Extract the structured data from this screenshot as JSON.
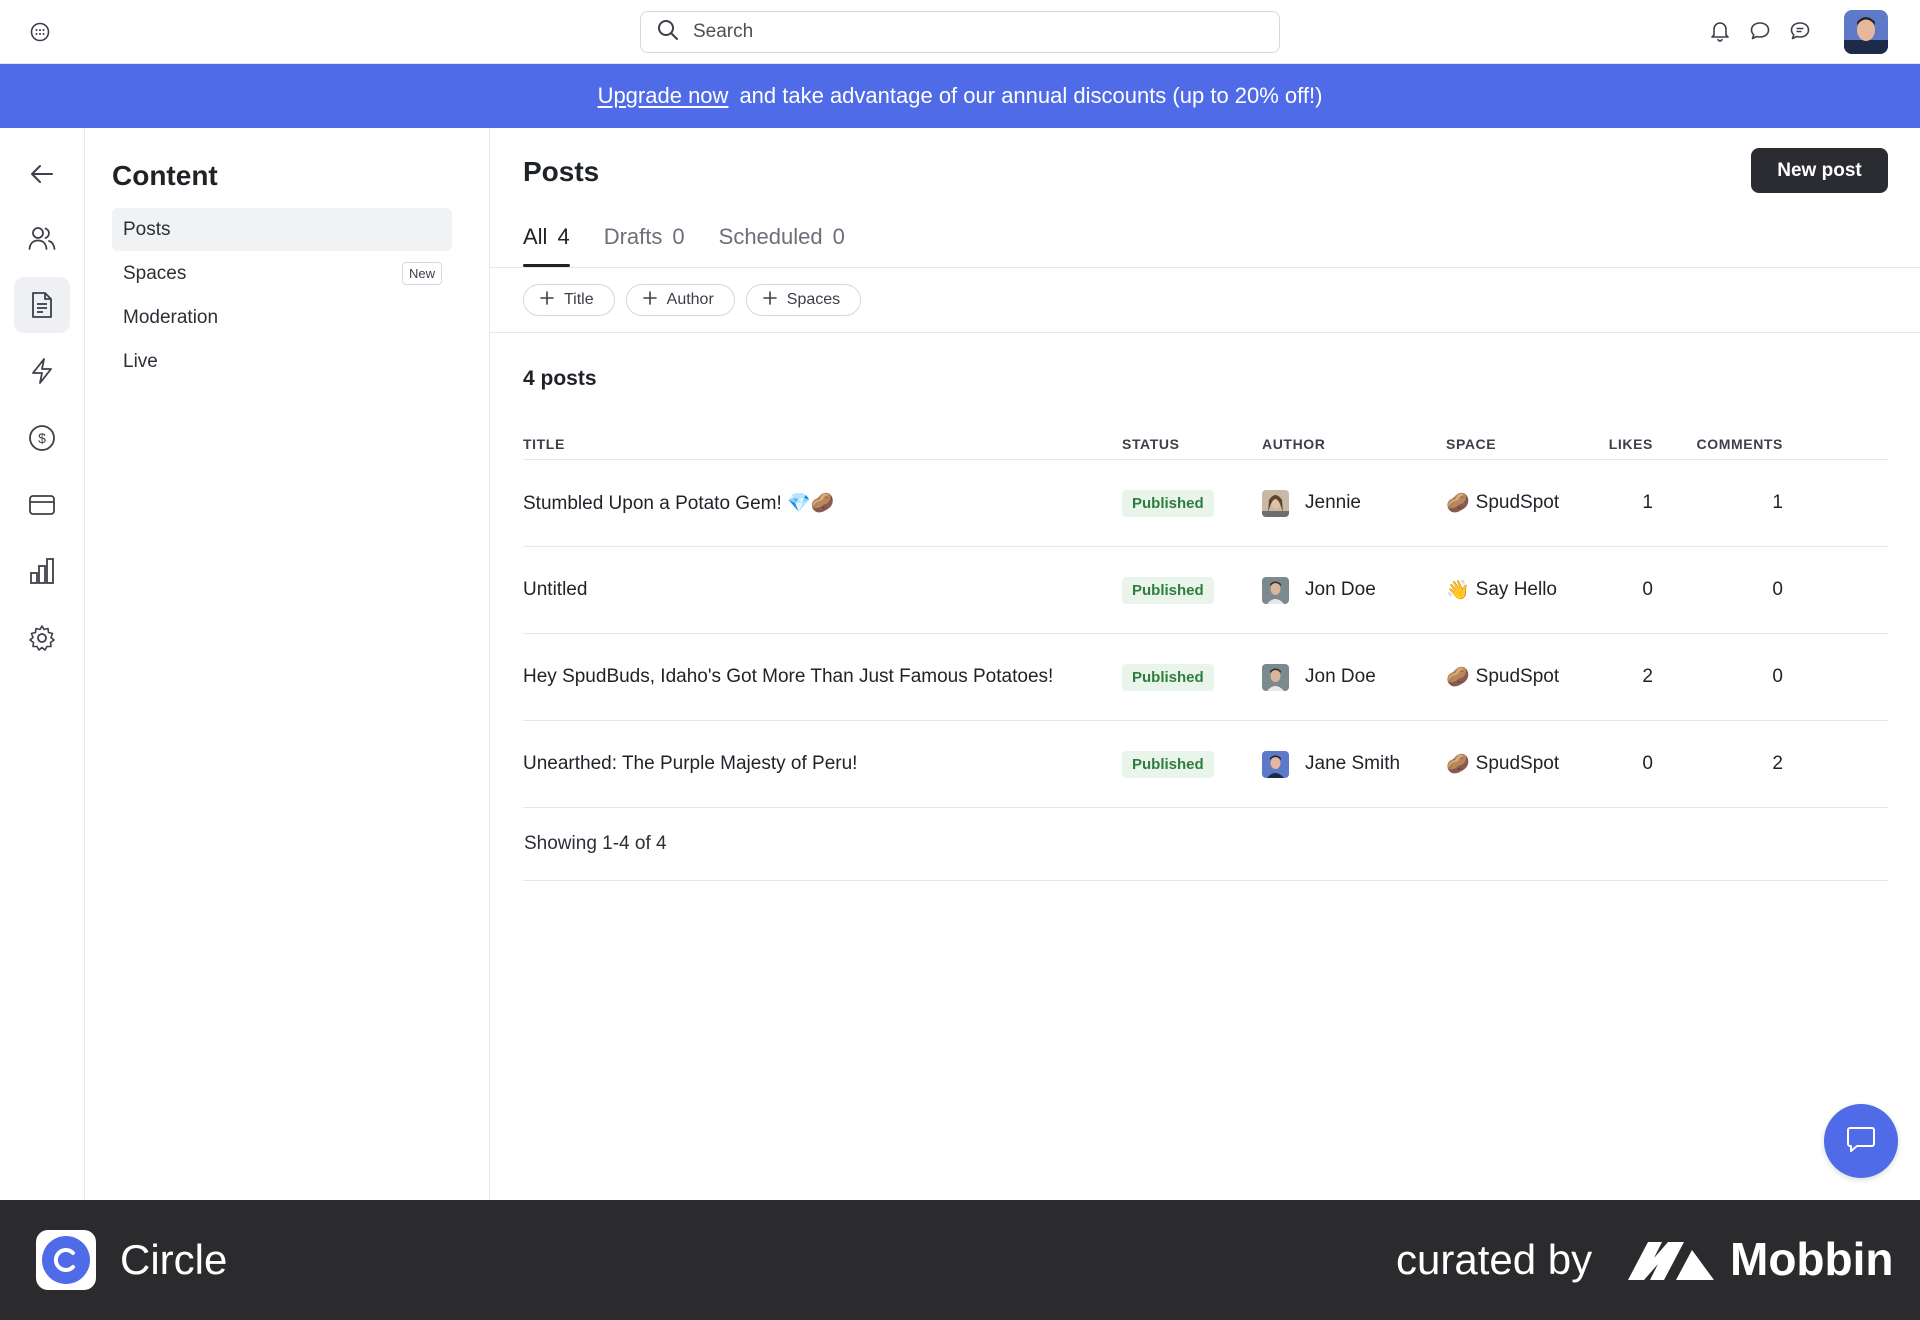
{
  "topbar": {
    "search_placeholder": "Search"
  },
  "banner": {
    "link_text": "Upgrade now",
    "text": "and take advantage of our annual discounts (up to 20% off!)"
  },
  "rail": {
    "items": [
      "back-arrow-icon",
      "members-icon",
      "content-icon",
      "workflows-icon",
      "paywalls-icon",
      "billing-icon",
      "analytics-icon",
      "settings-icon"
    ],
    "active": "content-icon"
  },
  "sidebar": {
    "title": "Content",
    "items": [
      {
        "label": "Posts",
        "active": true
      },
      {
        "label": "Spaces",
        "badge": "New"
      },
      {
        "label": "Moderation"
      },
      {
        "label": "Live"
      }
    ]
  },
  "main": {
    "title": "Posts",
    "new_post_label": "New post",
    "tabs": [
      {
        "label": "All",
        "count": "4",
        "active": true
      },
      {
        "label": "Drafts",
        "count": "0"
      },
      {
        "label": "Scheduled",
        "count": "0"
      }
    ],
    "filters": [
      "Title",
      "Author",
      "Spaces"
    ],
    "count_label": "4 posts",
    "columns": [
      "TITLE",
      "STATUS",
      "AUTHOR",
      "SPACE",
      "LIKES",
      "COMMENTS"
    ],
    "rows": [
      {
        "title": "Stumbled Upon a Potato Gem! 💎🥔",
        "status": "Published",
        "author": "Jennie",
        "space_emoji": "🥔",
        "space": "SpudSpot",
        "likes": "1",
        "comments": "1"
      },
      {
        "title": "Untitled",
        "status": "Published",
        "author": "Jon Doe",
        "space_emoji": "👋",
        "space": "Say Hello",
        "likes": "0",
        "comments": "0"
      },
      {
        "title": "Hey SpudBuds, Idaho's Got More Than Just Famous Potatoes!",
        "status": "Published",
        "author": "Jon Doe",
        "space_emoji": "🥔",
        "space": "SpudSpot",
        "likes": "2",
        "comments": "0"
      },
      {
        "title": "Unearthed: The Purple Majesty of Peru!",
        "status": "Published",
        "author": "Jane Smith",
        "space_emoji": "🥔",
        "space": "SpudSpot",
        "likes": "0",
        "comments": "2"
      }
    ],
    "showing": "Showing 1-4 of 4"
  },
  "brand": {
    "app_name": "Circle",
    "curated_by": "curated by",
    "mobbin": "Mobbin"
  },
  "colors": {
    "accent": "#4f6be8",
    "published_bg": "#e9f5eb",
    "published_text": "#2f7d3e",
    "brandbar": "#2b2b2d"
  }
}
